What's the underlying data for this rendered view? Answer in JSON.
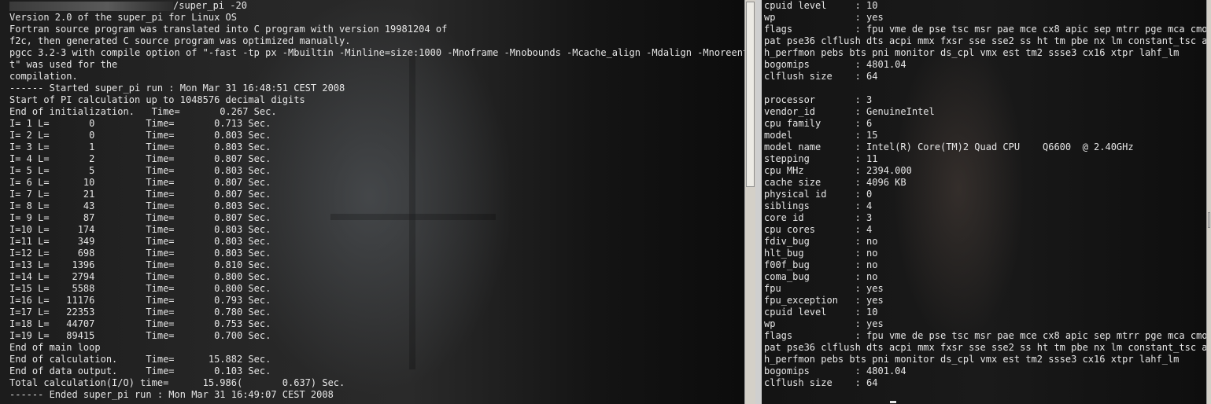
{
  "left_terminal": {
    "prompt_suffix": "/super_pi -20",
    "lines": [
      "Version 2.0 of the super_pi for Linux OS",
      "Fortran source program was translated into C program with version 19981204 of",
      "f2c, then generated C source program was optimized manually.",
      "pgcc 3.2-3 with compile option of \"-fast -tp px -Mbuiltin -Minline=size:1000 -Mnoframe -Mnobounds -Mcache_align -Mdalign -Mnoreentran",
      "t\" was used for the",
      "compilation.",
      "------ Started super_pi run : Mon Mar 31 16:48:51 CEST 2008",
      "Start of PI calculation up to 1048576 decimal digits",
      "End of initialization.   Time=       0.267 Sec.",
      "I= 1 L=       0         Time=       0.713 Sec.",
      "I= 2 L=       0         Time=       0.803 Sec.",
      "I= 3 L=       1         Time=       0.803 Sec.",
      "I= 4 L=       2         Time=       0.807 Sec.",
      "I= 5 L=       5         Time=       0.803 Sec.",
      "I= 6 L=      10         Time=       0.807 Sec.",
      "I= 7 L=      21         Time=       0.807 Sec.",
      "I= 8 L=      43         Time=       0.803 Sec.",
      "I= 9 L=      87         Time=       0.807 Sec.",
      "I=10 L=     174         Time=       0.803 Sec.",
      "I=11 L=     349         Time=       0.803 Sec.",
      "I=12 L=     698         Time=       0.803 Sec.",
      "I=13 L=    1396         Time=       0.810 Sec.",
      "I=14 L=    2794         Time=       0.800 Sec.",
      "I=15 L=    5588         Time=       0.800 Sec.",
      "I=16 L=   11176         Time=       0.793 Sec.",
      "I=17 L=   22353         Time=       0.780 Sec.",
      "I=18 L=   44707         Time=       0.753 Sec.",
      "I=19 L=   89415         Time=       0.700 Sec.",
      "End of main loop",
      "End of calculation.     Time=      15.882 Sec.",
      "End of data output.     Time=       0.103 Sec.",
      "Total calculation(I/O) time=      15.986(       0.637) Sec.",
      "------ Ended super_pi run : Mon Mar 31 16:49:07 CEST 2008"
    ]
  },
  "right_terminal": {
    "lines": [
      "cpuid level     : 10",
      "wp              : yes",
      "flags           : fpu vme de pse tsc msr pae mce cx8 apic sep mtrr pge mca cmov",
      "pat pse36 clflush dts acpi mmx fxsr sse sse2 ss ht tm pbe nx lm constant_tsc arc",
      "h_perfmon pebs bts pni monitor ds_cpl vmx est tm2 ssse3 cx16 xtpr lahf_lm",
      "bogomips        : 4801.04",
      "clflush size    : 64",
      "",
      "processor       : 3",
      "vendor_id       : GenuineIntel",
      "cpu family      : 6",
      "model           : 15",
      "model name      : Intel(R) Core(TM)2 Quad CPU    Q6600  @ 2.40GHz",
      "stepping        : 11",
      "cpu MHz         : 2394.000",
      "cache size      : 4096 KB",
      "physical id     : 0",
      "siblings        : 4",
      "core id         : 3",
      "cpu cores       : 4",
      "fdiv_bug        : no",
      "hlt_bug         : no",
      "f00f_bug        : no",
      "coma_bug        : no",
      "fpu             : yes",
      "fpu_exception   : yes",
      "cpuid level     : 10",
      "wp              : yes",
      "flags           : fpu vme de pse tsc msr pae mce cx8 apic sep mtrr pge mca cmov",
      "pat pse36 clflush dts acpi mmx fxsr sse sse2 ss ht tm pbe nx lm constant_tsc arc",
      "h_perfmon pebs bts pni monitor ds_cpl vmx est tm2 ssse3 cx16 xtpr lahf_lm",
      "bogomips        : 4801.04",
      "clflush size    : 64"
    ]
  }
}
